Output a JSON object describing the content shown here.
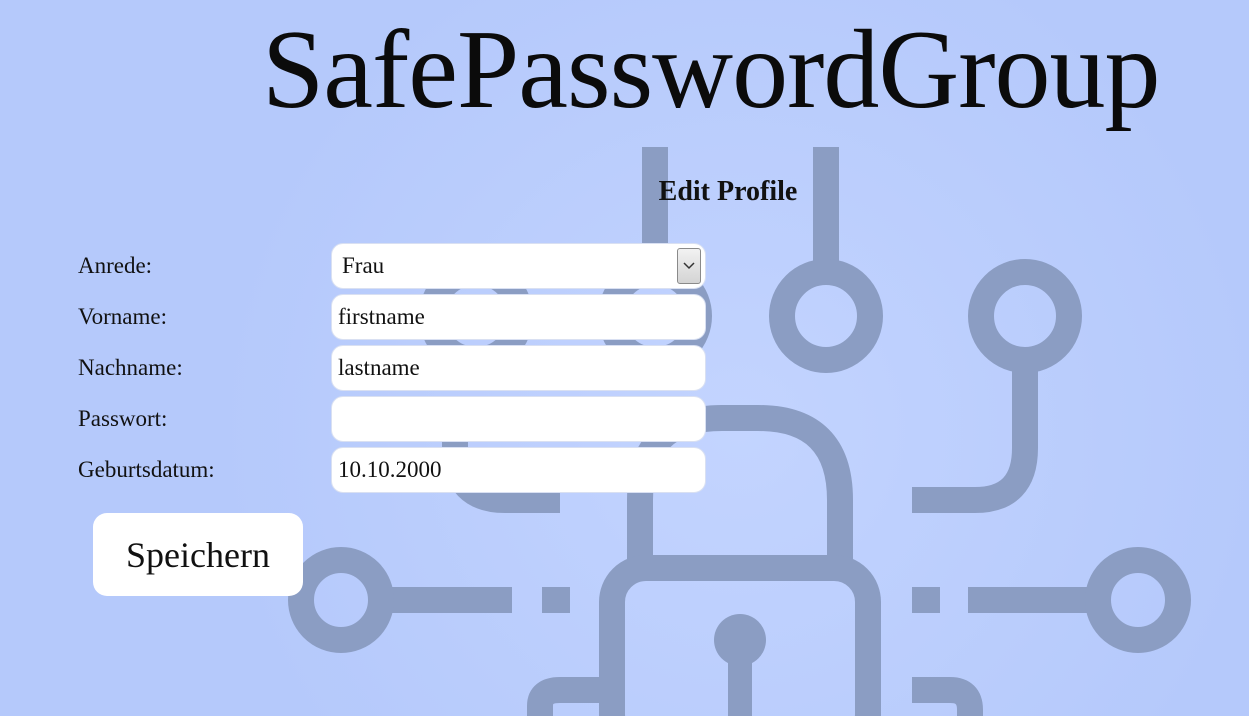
{
  "header": {
    "title": "SafePasswordGroup"
  },
  "page": {
    "heading": "Edit Profile"
  },
  "form": {
    "salutation": {
      "label": "Anrede:",
      "value": "Frau"
    },
    "firstname": {
      "label": "Vorname:",
      "value": "firstname"
    },
    "lastname": {
      "label": "Nachname:",
      "value": "lastname"
    },
    "password": {
      "label": "Passwort:",
      "value": ""
    },
    "birthdate": {
      "label": "Geburtsdatum:",
      "value": "10.10.2000"
    },
    "save_label": "Speichern"
  },
  "background": {
    "icon": "circuit-padlock-icon",
    "color": "#b5c9fb",
    "icon_color": "#8b9dc3"
  }
}
